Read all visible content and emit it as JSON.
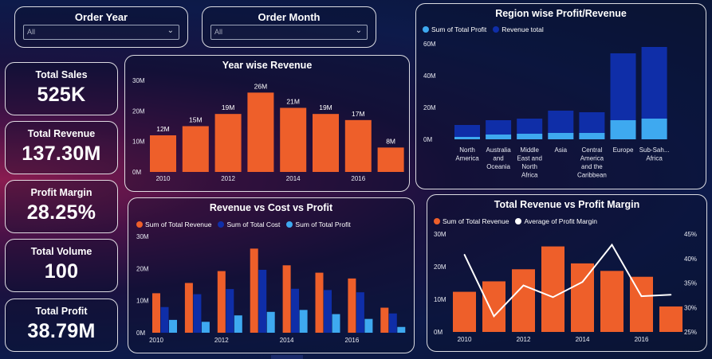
{
  "slicers": [
    {
      "title": "Order Year",
      "value": "All"
    },
    {
      "title": "Order Month",
      "value": "All"
    }
  ],
  "kpis": [
    {
      "title": "Total Sales",
      "value": "525K"
    },
    {
      "title": "Total Revenue",
      "value": "137.30M"
    },
    {
      "title": "Profit Margin",
      "value": "28.25%"
    },
    {
      "title": "Total Volume",
      "value": "100"
    },
    {
      "title": "Total Profit",
      "value": "38.79M"
    }
  ],
  "colors": {
    "orange": "#ee5f2a",
    "dark_blue": "#0f2ea8",
    "light_blue": "#3ea9f0",
    "line_white": "#ffffff"
  },
  "chart_data": [
    {
      "id": "year-revenue",
      "type": "bar",
      "title": "Year wise Revenue",
      "categories": [
        "2010",
        "2011",
        "2012",
        "2013",
        "2014",
        "2015",
        "2016",
        "2017"
      ],
      "x_tick_labels": [
        "2010",
        "",
        "2012",
        "",
        "2014",
        "",
        "2016",
        ""
      ],
      "values": [
        12,
        15,
        19,
        26,
        21,
        19,
        17,
        8
      ],
      "data_labels": [
        "12M",
        "15M",
        "19M",
        "26M",
        "21M",
        "19M",
        "17M",
        "8M"
      ],
      "y_ticks": [
        "0M",
        "10M",
        "20M",
        "30M"
      ],
      "ylim": [
        0,
        30
      ],
      "unit": "M",
      "grid": false
    },
    {
      "id": "region-profit-revenue",
      "type": "bar",
      "title": "Region wise Profit/Revenue",
      "categories": [
        "North America",
        "Australia and Oceania",
        "Middle East and North Africa",
        "Asia",
        "Central America and the Caribbean",
        "Europe",
        "Sub-Sah... Africa"
      ],
      "category_label_lines": [
        [
          "North",
          "America"
        ],
        [
          "Australia",
          "and",
          "Oceania"
        ],
        [
          "Middle",
          "East and",
          "North",
          "Africa"
        ],
        [
          "Asia"
        ],
        [
          "Central",
          "America",
          "and the",
          "Caribbean"
        ],
        [
          "Europe"
        ],
        [
          "Sub-Sah...",
          "Africa"
        ]
      ],
      "series": [
        {
          "name": "Sum of Total Profit",
          "values": [
            1.5,
            3,
            3.5,
            4,
            4,
            12,
            13
          ]
        },
        {
          "name": "Revenue total",
          "values": [
            9,
            12,
            13,
            18,
            17,
            54,
            58
          ]
        }
      ],
      "y_ticks": [
        "0M",
        "20M",
        "40M",
        "60M"
      ],
      "ylim": [
        0,
        60
      ],
      "legend_position": "top-left",
      "grid": false
    },
    {
      "id": "revenue-cost-profit",
      "type": "bar",
      "title": "Revenue vs Cost vs Profit",
      "categories": [
        "2010",
        "2011",
        "2012",
        "2013",
        "2014",
        "2015",
        "2016",
        "2017"
      ],
      "x_tick_labels": [
        "2010",
        "",
        "2012",
        "",
        "2014",
        "",
        "2016",
        ""
      ],
      "series": [
        {
          "name": "Sum of Total Revenue",
          "values": [
            12.3,
            15.5,
            19.2,
            26.2,
            21,
            18.7,
            16.9,
            7.8
          ]
        },
        {
          "name": "Sum of Total Cost",
          "values": [
            8,
            12,
            13.6,
            19.6,
            13.7,
            13.3,
            12.6,
            6
          ]
        },
        {
          "name": "Sum of Total Profit",
          "values": [
            4,
            3.4,
            5.4,
            6.5,
            7.1,
            5.8,
            4.3,
            1.8
          ]
        }
      ],
      "y_ticks": [
        "0M",
        "10M",
        "20M",
        "30M"
      ],
      "ylim": [
        0,
        30
      ],
      "legend_position": "top-left",
      "grid": false
    },
    {
      "id": "revenue-vs-margin",
      "type": "bar",
      "title": "Total Revenue vs Profit Margin",
      "categories": [
        "2010",
        "2011",
        "2012",
        "2013",
        "2014",
        "2015",
        "2016",
        "2017"
      ],
      "x_tick_labels": [
        "2010",
        "",
        "2012",
        "",
        "2014",
        "",
        "2016",
        ""
      ],
      "series": [
        {
          "name": "Sum of Total Revenue",
          "type": "bar",
          "values": [
            12.3,
            15.5,
            19.2,
            26.2,
            21,
            18.7,
            16.9,
            7.8
          ]
        },
        {
          "name": "Average of Profit Margin",
          "type": "line",
          "values": [
            40.8,
            28.2,
            34.5,
            32.1,
            35.2,
            42.8,
            32.3,
            32.6
          ]
        }
      ],
      "y_ticks": [
        "0M",
        "10M",
        "20M",
        "30M"
      ],
      "ylim": [
        0,
        30
      ],
      "y2_ticks": [
        "25%",
        "30%",
        "35%",
        "40%",
        "45%"
      ],
      "y2lim": [
        25,
        45
      ],
      "legend_position": "top-left",
      "grid": false
    }
  ]
}
